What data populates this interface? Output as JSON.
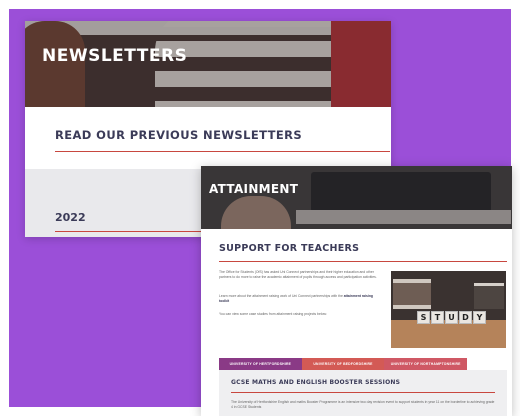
{
  "newsletters_card": {
    "title": "NEWSLETTERS",
    "subtitle": "READ OUR PREVIOUS NEWSLETTERS",
    "year": "2022"
  },
  "attainment_card": {
    "title": "ATTAINMENT",
    "heading": "SUPPORT FOR TEACHERS",
    "paragraphs": [
      "The Office for Students (OfS) has asked Uni Connect partnerships and their higher education and other partners to do more to raise the academic attainment of pupils through access and participation activities.",
      "Learn more about the attainment raising work of Uni Connect partnerships with the",
      "You can view some case studies from attainment raising projects below:"
    ],
    "link_text": "attainment raising toolkit",
    "image": {
      "dice_letters": [
        "S",
        "T",
        "U",
        "D",
        "Y"
      ]
    },
    "tabs": [
      {
        "label": "UNIVERSITY OF HERTFORDSHIRE",
        "color": "#8a3a86"
      },
      {
        "label": "UNIVERSITY OF BEDFORDSHIRE",
        "color": "#d35a55"
      },
      {
        "label": "UNIVERSITY OF NORTHAMPTONSHIRE",
        "color": "#cf5864"
      }
    ],
    "panel": {
      "heading": "GCSE MATHS AND ENGLISH BOOSTER SESSIONS",
      "text": "The University of Hertfordshire English and maths Booster Programme is an intensive two day revision event to support students in year 11 on the borderline to achieving grade 4 in GCSE Students"
    }
  },
  "colors": {
    "frame": "#9b4fd8",
    "heading": "#3b3b58",
    "accent_rule": "#c8473f"
  }
}
